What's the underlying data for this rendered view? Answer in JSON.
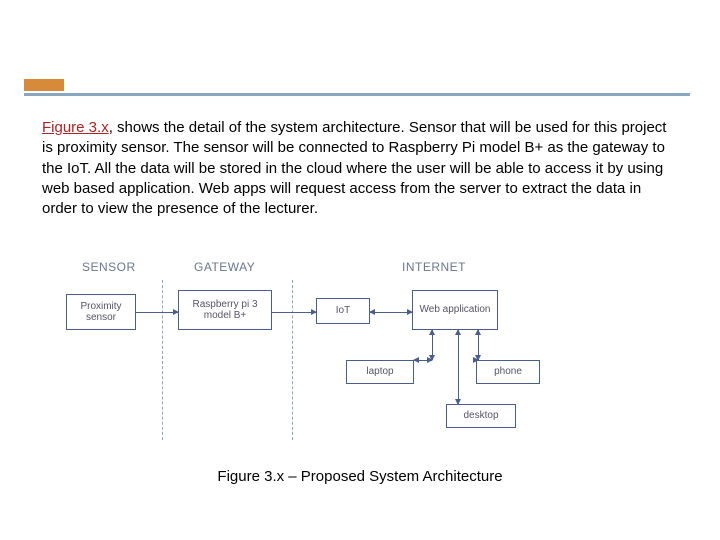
{
  "paragraph": {
    "ref": "Figure 3.x",
    "rest": ", shows the detail of the system architecture. Sensor that will be used for this project is proximity sensor. The sensor will be connected to Raspberry Pi model B+ as the gateway to the IoT. All the data will be stored in the cloud where the user will be able to access it by using web based application. Web apps will request access from the server to extract the data in order to view the presence of the lecturer."
  },
  "diagram": {
    "headers": {
      "sensor": "SENSOR",
      "gateway": "GATEWAY",
      "internet": "INTERNET"
    },
    "nodes": {
      "proximity": "Proximity sensor",
      "rpi": "Raspberry pi 3 model B+",
      "iot": "IoT",
      "web": "Web application",
      "laptop": "laptop",
      "phone": "phone",
      "desktop": "desktop"
    }
  },
  "caption": "Figure 3.x – Proposed System Architecture",
  "chart_data": {
    "type": "diagram",
    "title": "Proposed System Architecture",
    "columns": [
      "SENSOR",
      "GATEWAY",
      "INTERNET"
    ],
    "nodes": [
      {
        "id": "proximity",
        "label": "Proximity sensor",
        "column": "SENSOR"
      },
      {
        "id": "rpi",
        "label": "Raspberry pi 3 model B+",
        "column": "GATEWAY"
      },
      {
        "id": "iot",
        "label": "IoT",
        "column": "INTERNET"
      },
      {
        "id": "web",
        "label": "Web application",
        "column": "INTERNET"
      },
      {
        "id": "laptop",
        "label": "laptop",
        "column": "INTERNET"
      },
      {
        "id": "phone",
        "label": "phone",
        "column": "INTERNET"
      },
      {
        "id": "desktop",
        "label": "desktop",
        "column": "INTERNET"
      }
    ],
    "edges": [
      {
        "from": "proximity",
        "to": "rpi",
        "bidirectional": false
      },
      {
        "from": "rpi",
        "to": "iot",
        "bidirectional": false
      },
      {
        "from": "iot",
        "to": "web",
        "bidirectional": true
      },
      {
        "from": "web",
        "to": "laptop",
        "bidirectional": true
      },
      {
        "from": "web",
        "to": "phone",
        "bidirectional": true
      },
      {
        "from": "web",
        "to": "desktop",
        "bidirectional": true
      }
    ]
  }
}
